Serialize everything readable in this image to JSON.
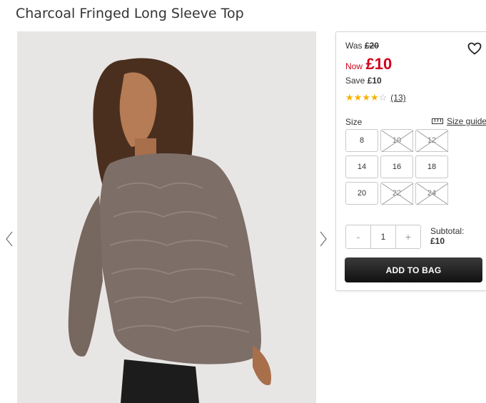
{
  "product": {
    "title": "Charcoal Fringed Long Sleeve Top"
  },
  "gallery": {
    "prev_icon": "chevron-left-icon",
    "next_icon": "chevron-right-icon"
  },
  "pricing": {
    "was_label": "Was",
    "was_price": "£20",
    "now_label": "Now",
    "now_price": "£10",
    "save_label": "Save",
    "save_amount": "£10"
  },
  "rating": {
    "stars_filled": 4,
    "stars_total": 5,
    "review_count": "(13)"
  },
  "sizes": {
    "label": "Size",
    "guide_label": "Size guide",
    "options": [
      {
        "size": "8",
        "available": true
      },
      {
        "size": "10",
        "available": false
      },
      {
        "size": "12",
        "available": false
      },
      {
        "size": "14",
        "available": true
      },
      {
        "size": "16",
        "available": true
      },
      {
        "size": "18",
        "available": true
      },
      {
        "size": "20",
        "available": true
      },
      {
        "size": "22",
        "available": false
      },
      {
        "size": "24",
        "available": false
      }
    ]
  },
  "quantity": {
    "minus": "-",
    "value": "1",
    "plus": "+"
  },
  "subtotal": {
    "label": "Subtotal:",
    "value": "£10"
  },
  "actions": {
    "add_to_bag": "ADD TO BAG"
  },
  "colors": {
    "price_red": "#d0021b",
    "star_gold": "#f5b301",
    "button_dark": "#1a1a1a"
  }
}
